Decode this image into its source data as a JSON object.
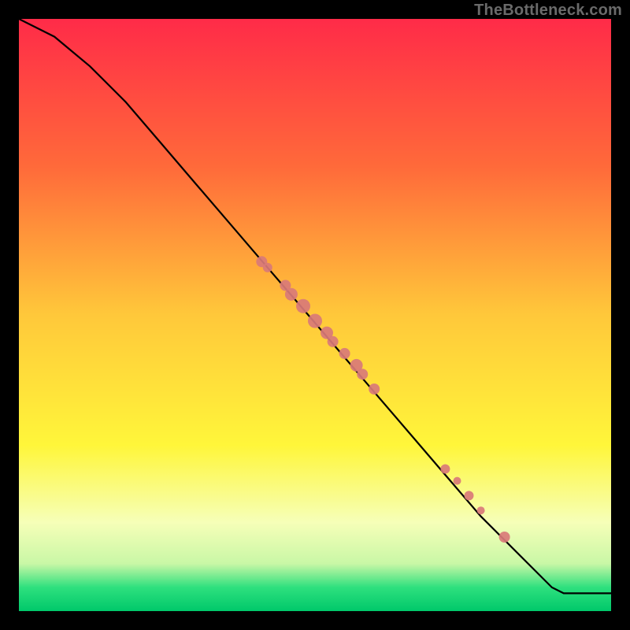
{
  "watermark": "TheBottleneck.com",
  "colors": {
    "frame": "#000000",
    "curve": "#000000",
    "points": "#d97a78",
    "gradient_stops": [
      {
        "pct": 0,
        "color": "#ff2b48"
      },
      {
        "pct": 25,
        "color": "#ff6a3a"
      },
      {
        "pct": 50,
        "color": "#ffc83a"
      },
      {
        "pct": 72,
        "color": "#fff63a"
      },
      {
        "pct": 85,
        "color": "#f6ffb8"
      },
      {
        "pct": 92,
        "color": "#c9f7a6"
      },
      {
        "pct": 96,
        "color": "#2ee07e"
      },
      {
        "pct": 100,
        "color": "#00c86a"
      }
    ]
  },
  "chart_data": {
    "type": "line",
    "title": "",
    "xlabel": "",
    "ylabel": "",
    "xlim": [
      0,
      100
    ],
    "ylim": [
      0,
      100
    ],
    "series": [
      {
        "name": "curve",
        "x": [
          0,
          6,
          12,
          18,
          24,
          30,
          36,
          42,
          48,
          54,
          60,
          66,
          72,
          78,
          84,
          90,
          92,
          100
        ],
        "y": [
          100,
          97,
          92,
          86,
          79,
          72,
          65,
          58,
          51,
          44,
          37,
          30,
          23,
          16,
          10,
          4,
          3,
          3
        ]
      }
    ],
    "points": [
      {
        "x": 41,
        "y": 59,
        "r": 7
      },
      {
        "x": 42,
        "y": 58,
        "r": 6
      },
      {
        "x": 45,
        "y": 55,
        "r": 7
      },
      {
        "x": 46,
        "y": 53.5,
        "r": 8
      },
      {
        "x": 48,
        "y": 51.5,
        "r": 9
      },
      {
        "x": 50,
        "y": 49,
        "r": 9
      },
      {
        "x": 52,
        "y": 47,
        "r": 8
      },
      {
        "x": 53,
        "y": 45.5,
        "r": 7
      },
      {
        "x": 55,
        "y": 43.5,
        "r": 7
      },
      {
        "x": 57,
        "y": 41.5,
        "r": 8
      },
      {
        "x": 58,
        "y": 40,
        "r": 7
      },
      {
        "x": 60,
        "y": 37.5,
        "r": 7
      },
      {
        "x": 72,
        "y": 24,
        "r": 6
      },
      {
        "x": 74,
        "y": 22,
        "r": 5
      },
      {
        "x": 76,
        "y": 19.5,
        "r": 6
      },
      {
        "x": 78,
        "y": 17,
        "r": 5
      },
      {
        "x": 82,
        "y": 12.5,
        "r": 7
      }
    ]
  }
}
